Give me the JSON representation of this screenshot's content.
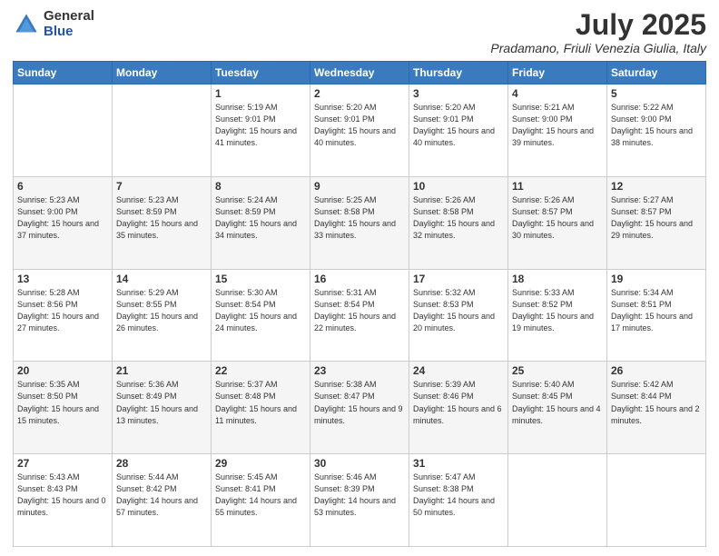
{
  "logo": {
    "general": "General",
    "blue": "Blue"
  },
  "title": "July 2025",
  "subtitle": "Pradamano, Friuli Venezia Giulia, Italy",
  "days_of_week": [
    "Sunday",
    "Monday",
    "Tuesday",
    "Wednesday",
    "Thursday",
    "Friday",
    "Saturday"
  ],
  "weeks": [
    [
      {
        "day": "",
        "info": ""
      },
      {
        "day": "",
        "info": ""
      },
      {
        "day": "1",
        "info": "Sunrise: 5:19 AM\nSunset: 9:01 PM\nDaylight: 15 hours and 41 minutes."
      },
      {
        "day": "2",
        "info": "Sunrise: 5:20 AM\nSunset: 9:01 PM\nDaylight: 15 hours and 40 minutes."
      },
      {
        "day": "3",
        "info": "Sunrise: 5:20 AM\nSunset: 9:01 PM\nDaylight: 15 hours and 40 minutes."
      },
      {
        "day": "4",
        "info": "Sunrise: 5:21 AM\nSunset: 9:00 PM\nDaylight: 15 hours and 39 minutes."
      },
      {
        "day": "5",
        "info": "Sunrise: 5:22 AM\nSunset: 9:00 PM\nDaylight: 15 hours and 38 minutes."
      }
    ],
    [
      {
        "day": "6",
        "info": "Sunrise: 5:23 AM\nSunset: 9:00 PM\nDaylight: 15 hours and 37 minutes."
      },
      {
        "day": "7",
        "info": "Sunrise: 5:23 AM\nSunset: 8:59 PM\nDaylight: 15 hours and 35 minutes."
      },
      {
        "day": "8",
        "info": "Sunrise: 5:24 AM\nSunset: 8:59 PM\nDaylight: 15 hours and 34 minutes."
      },
      {
        "day": "9",
        "info": "Sunrise: 5:25 AM\nSunset: 8:58 PM\nDaylight: 15 hours and 33 minutes."
      },
      {
        "day": "10",
        "info": "Sunrise: 5:26 AM\nSunset: 8:58 PM\nDaylight: 15 hours and 32 minutes."
      },
      {
        "day": "11",
        "info": "Sunrise: 5:26 AM\nSunset: 8:57 PM\nDaylight: 15 hours and 30 minutes."
      },
      {
        "day": "12",
        "info": "Sunrise: 5:27 AM\nSunset: 8:57 PM\nDaylight: 15 hours and 29 minutes."
      }
    ],
    [
      {
        "day": "13",
        "info": "Sunrise: 5:28 AM\nSunset: 8:56 PM\nDaylight: 15 hours and 27 minutes."
      },
      {
        "day": "14",
        "info": "Sunrise: 5:29 AM\nSunset: 8:55 PM\nDaylight: 15 hours and 26 minutes."
      },
      {
        "day": "15",
        "info": "Sunrise: 5:30 AM\nSunset: 8:54 PM\nDaylight: 15 hours and 24 minutes."
      },
      {
        "day": "16",
        "info": "Sunrise: 5:31 AM\nSunset: 8:54 PM\nDaylight: 15 hours and 22 minutes."
      },
      {
        "day": "17",
        "info": "Sunrise: 5:32 AM\nSunset: 8:53 PM\nDaylight: 15 hours and 20 minutes."
      },
      {
        "day": "18",
        "info": "Sunrise: 5:33 AM\nSunset: 8:52 PM\nDaylight: 15 hours and 19 minutes."
      },
      {
        "day": "19",
        "info": "Sunrise: 5:34 AM\nSunset: 8:51 PM\nDaylight: 15 hours and 17 minutes."
      }
    ],
    [
      {
        "day": "20",
        "info": "Sunrise: 5:35 AM\nSunset: 8:50 PM\nDaylight: 15 hours and 15 minutes."
      },
      {
        "day": "21",
        "info": "Sunrise: 5:36 AM\nSunset: 8:49 PM\nDaylight: 15 hours and 13 minutes."
      },
      {
        "day": "22",
        "info": "Sunrise: 5:37 AM\nSunset: 8:48 PM\nDaylight: 15 hours and 11 minutes."
      },
      {
        "day": "23",
        "info": "Sunrise: 5:38 AM\nSunset: 8:47 PM\nDaylight: 15 hours and 9 minutes."
      },
      {
        "day": "24",
        "info": "Sunrise: 5:39 AM\nSunset: 8:46 PM\nDaylight: 15 hours and 6 minutes."
      },
      {
        "day": "25",
        "info": "Sunrise: 5:40 AM\nSunset: 8:45 PM\nDaylight: 15 hours and 4 minutes."
      },
      {
        "day": "26",
        "info": "Sunrise: 5:42 AM\nSunset: 8:44 PM\nDaylight: 15 hours and 2 minutes."
      }
    ],
    [
      {
        "day": "27",
        "info": "Sunrise: 5:43 AM\nSunset: 8:43 PM\nDaylight: 15 hours and 0 minutes."
      },
      {
        "day": "28",
        "info": "Sunrise: 5:44 AM\nSunset: 8:42 PM\nDaylight: 14 hours and 57 minutes."
      },
      {
        "day": "29",
        "info": "Sunrise: 5:45 AM\nSunset: 8:41 PM\nDaylight: 14 hours and 55 minutes."
      },
      {
        "day": "30",
        "info": "Sunrise: 5:46 AM\nSunset: 8:39 PM\nDaylight: 14 hours and 53 minutes."
      },
      {
        "day": "31",
        "info": "Sunrise: 5:47 AM\nSunset: 8:38 PM\nDaylight: 14 hours and 50 minutes."
      },
      {
        "day": "",
        "info": ""
      },
      {
        "day": "",
        "info": ""
      }
    ]
  ]
}
